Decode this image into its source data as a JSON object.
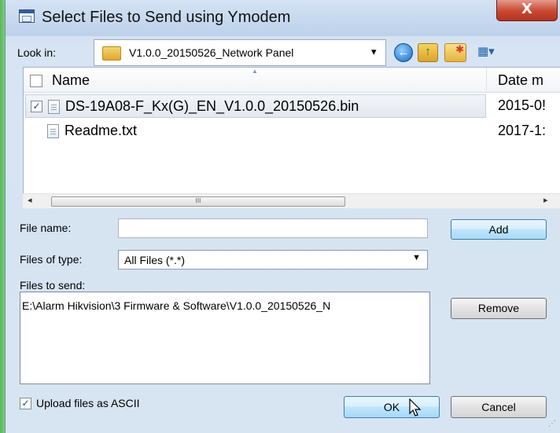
{
  "window": {
    "title": "Select Files to Send using Ymodem",
    "close_glyph": "X"
  },
  "lookin": {
    "label": "Look in:",
    "value": "V1.0.0_20150526_Network Panel",
    "dropdown_glyph": "▾"
  },
  "toolbar": {
    "back_glyph": "←",
    "up_glyph": "↑",
    "new_folder_glyph": "✱",
    "view_glyph": "▦▾"
  },
  "file_list": {
    "columns": {
      "name": "Name",
      "date": "Date m"
    },
    "rows": [
      {
        "name": "DS-19A08-F_Kx(G)_EN_V1.0.0_20150526.bin",
        "date": "2015-0!",
        "checked": "✓"
      },
      {
        "name": "Readme.txt",
        "date": "2017-1:"
      }
    ]
  },
  "scrollbar": {
    "left_arrow": "◂",
    "thumb_grip": "III",
    "right_arrow": "▸"
  },
  "file_name": {
    "label": "File name:",
    "value": ""
  },
  "add_button": "Add",
  "files_of_type": {
    "label": "Files of type:",
    "value": "All Files (*.*)",
    "arrow": "▼"
  },
  "files_to_send": {
    "label": "Files to send:",
    "entries": [
      "E:\\Alarm Hikvision\\3 Firmware & Software\\V1.0.0_20150526_N"
    ]
  },
  "remove_button": "Remove",
  "ascii_option": {
    "label": "Upload files as ASCII",
    "checked": "✓"
  },
  "ok_button": "OK",
  "cancel_button": "Cancel",
  "icons": {
    "title": "dialog-icon",
    "folder": "folder-icon",
    "back": "back-icon",
    "up": "up-folder-icon",
    "new_folder": "new-folder-icon",
    "view": "view-menu-icon"
  },
  "colors": {
    "window_bg": "#d7e4f2",
    "close_button": "#c9472f",
    "default_button": "#bee6fd",
    "accent_green": "#58b85c"
  }
}
